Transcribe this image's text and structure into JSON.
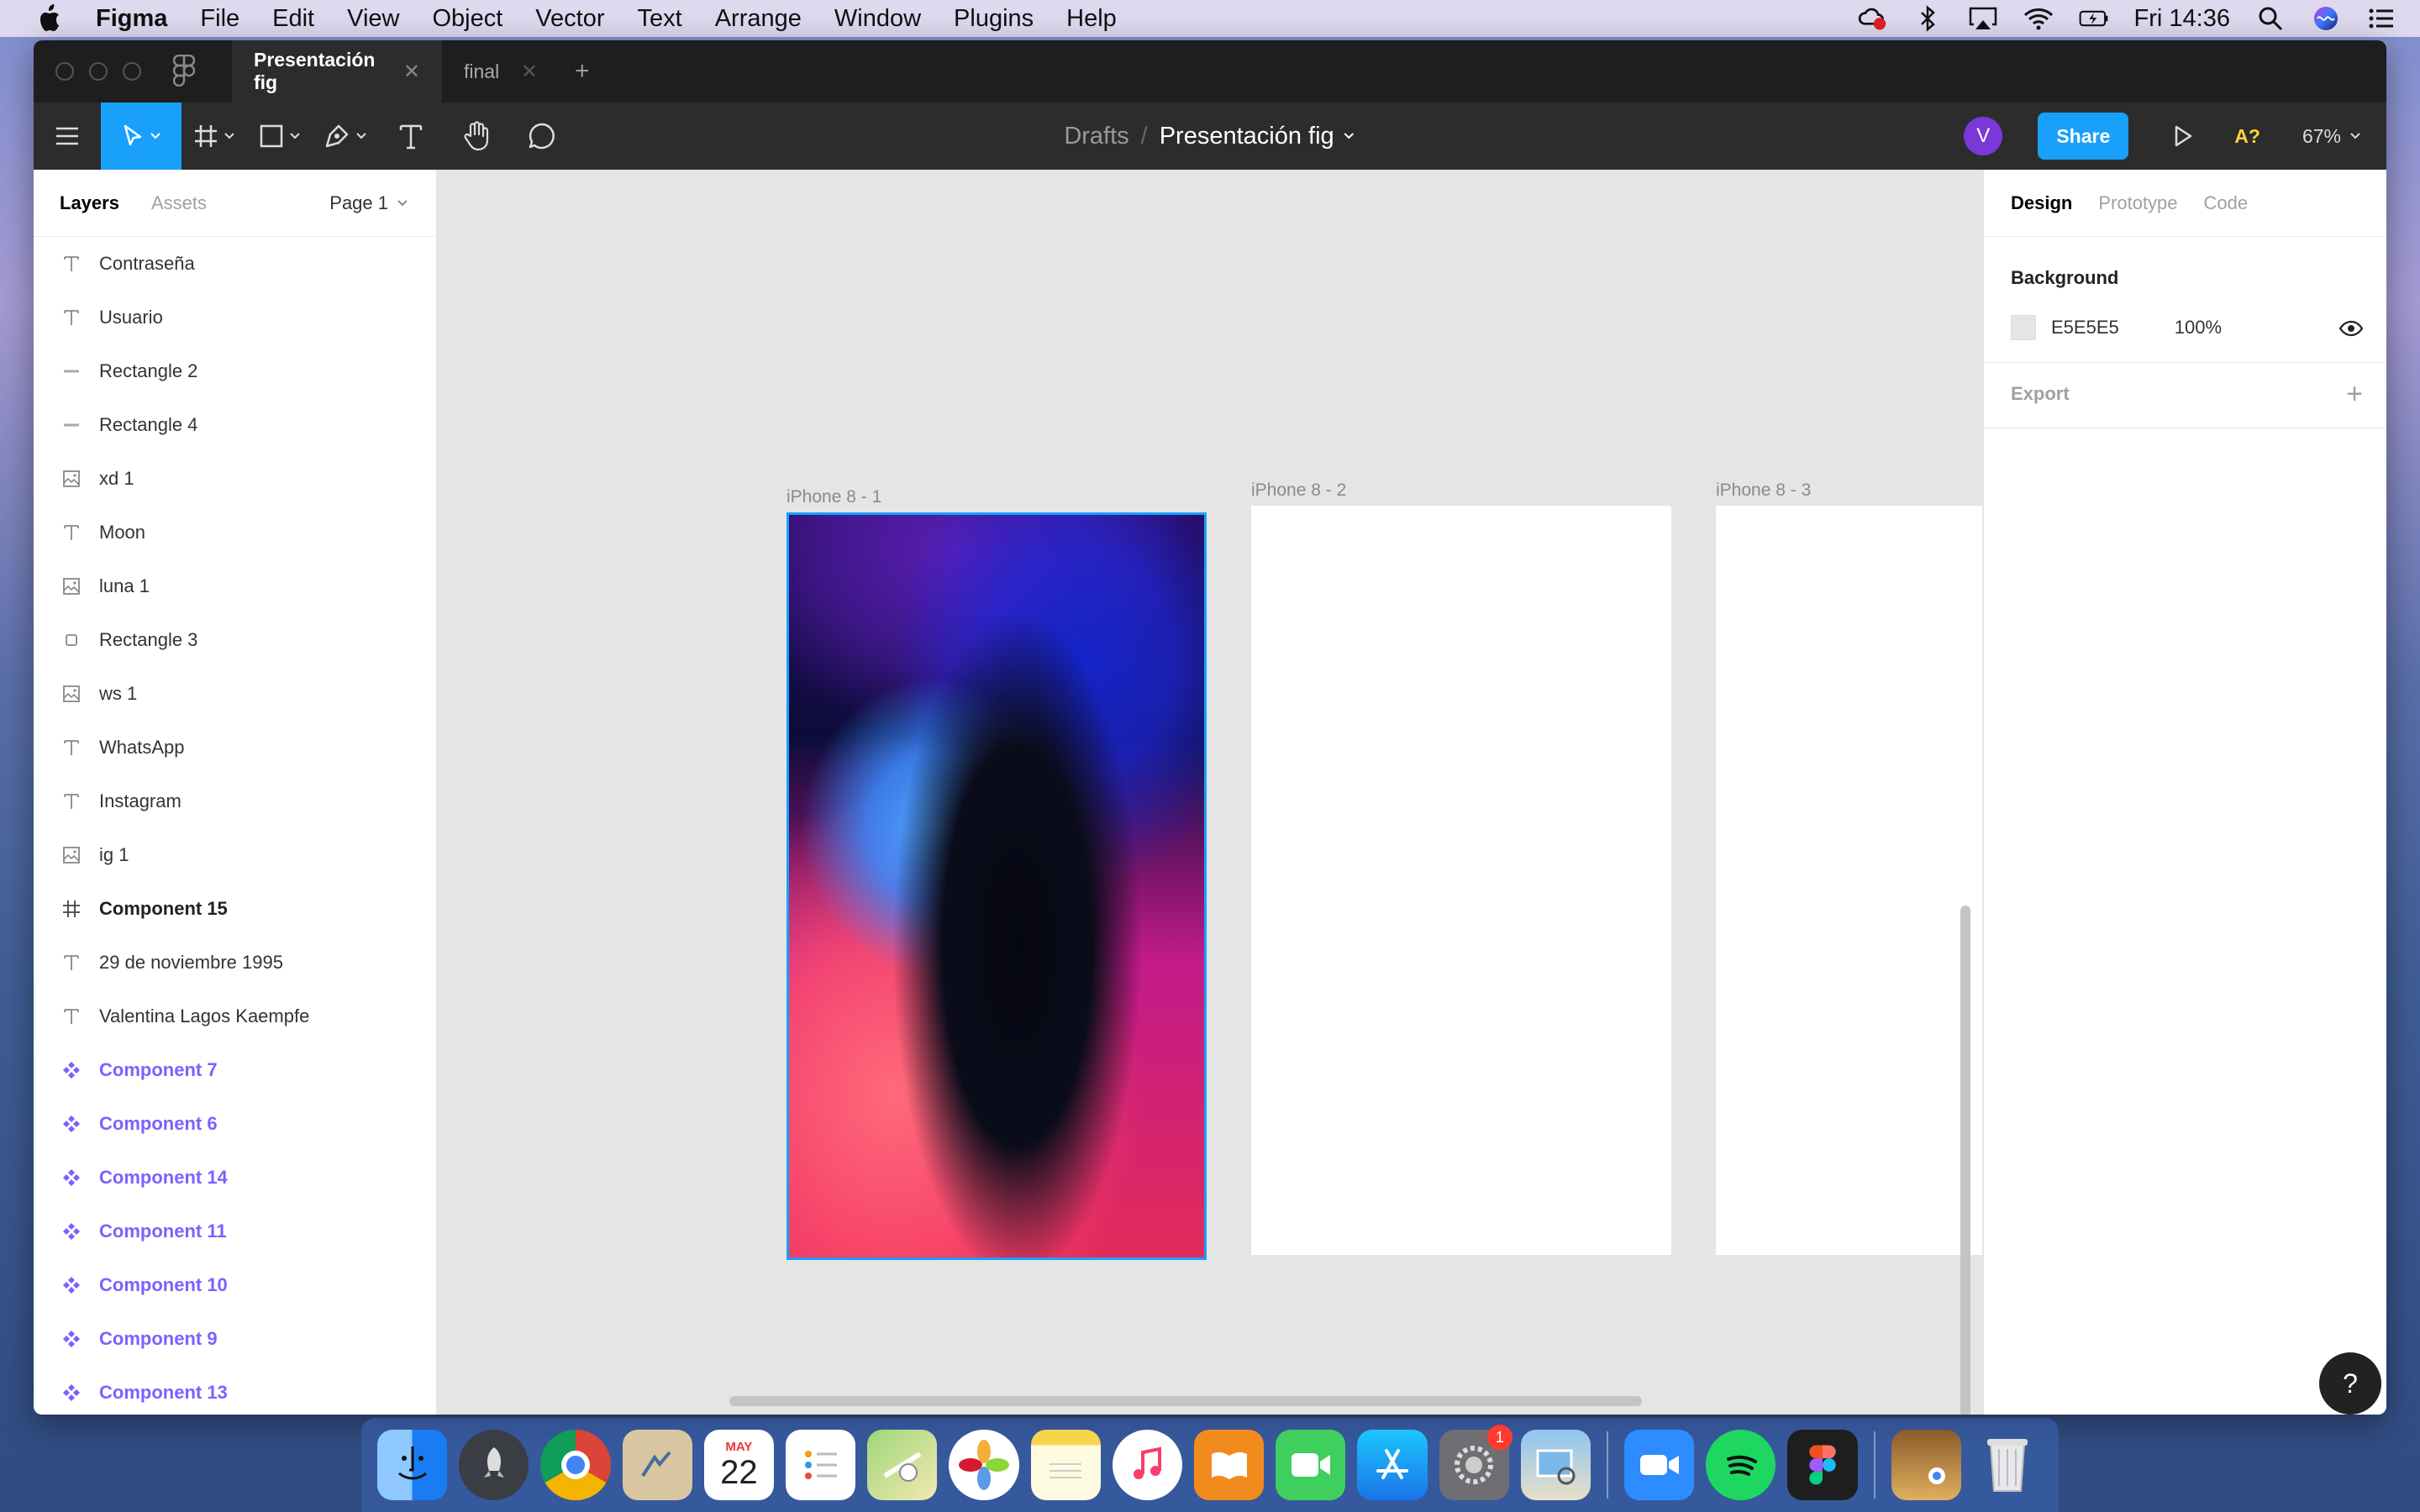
{
  "menubar": {
    "app_name": "Figma",
    "items": [
      "File",
      "Edit",
      "View",
      "Object",
      "Vector",
      "Text",
      "Arrange",
      "Window",
      "Plugins",
      "Help"
    ],
    "clock": "Fri 14:36"
  },
  "window": {
    "tabs": [
      {
        "label": "Presentación fig",
        "active": true
      },
      {
        "label": "final",
        "active": false
      }
    ],
    "breadcrumb": {
      "root": "Drafts",
      "separator": "/",
      "file": "Presentación fig"
    },
    "user_initial": "V",
    "share_label": "Share",
    "font_warning": "A?",
    "zoom": "67%"
  },
  "left_panel": {
    "tabs": [
      "Layers",
      "Assets"
    ],
    "page": "Page 1",
    "layers": [
      {
        "name": "Contraseña",
        "icon": "text-icon",
        "style": "normal"
      },
      {
        "name": "Usuario",
        "icon": "text-icon",
        "style": "normal"
      },
      {
        "name": "Rectangle 2",
        "icon": "line-icon",
        "style": "normal"
      },
      {
        "name": "Rectangle 4",
        "icon": "line-icon",
        "style": "normal"
      },
      {
        "name": "xd 1",
        "icon": "image-icon",
        "style": "normal"
      },
      {
        "name": "Moon",
        "icon": "text-icon",
        "style": "normal"
      },
      {
        "name": "luna 1",
        "icon": "image-icon",
        "style": "normal"
      },
      {
        "name": "Rectangle 3",
        "icon": "rectangle-icon",
        "style": "normal"
      },
      {
        "name": "ws 1",
        "icon": "image-icon",
        "style": "normal"
      },
      {
        "name": "WhatsApp",
        "icon": "text-icon",
        "style": "normal"
      },
      {
        "name": "Instagram",
        "icon": "text-icon",
        "style": "normal"
      },
      {
        "name": "ig 1",
        "icon": "image-icon",
        "style": "normal"
      },
      {
        "name": "Component 15",
        "icon": "frame-icon",
        "style": "bold"
      },
      {
        "name": "29 de noviembre 1995",
        "icon": "text-icon",
        "style": "normal"
      },
      {
        "name": "Valentina Lagos Kaempfe",
        "icon": "text-icon",
        "style": "normal"
      },
      {
        "name": "Component 7",
        "icon": "component-icon",
        "style": "component"
      },
      {
        "name": "Component 6",
        "icon": "component-icon",
        "style": "component"
      },
      {
        "name": "Component 14",
        "icon": "component-icon",
        "style": "component"
      },
      {
        "name": "Component 11",
        "icon": "component-icon",
        "style": "component"
      },
      {
        "name": "Component 10",
        "icon": "component-icon",
        "style": "component"
      },
      {
        "name": "Component 9",
        "icon": "component-icon",
        "style": "component"
      },
      {
        "name": "Component 13",
        "icon": "component-icon",
        "style": "component"
      }
    ]
  },
  "canvas": {
    "frames": [
      {
        "label": "iPhone 8 - 1",
        "selected": true
      },
      {
        "label": "iPhone 8 - 2",
        "selected": false
      },
      {
        "label": "iPhone 8 - 3",
        "selected": false
      }
    ]
  },
  "right_panel": {
    "tabs": [
      "Design",
      "Prototype",
      "Code"
    ],
    "background": {
      "title": "Background",
      "hex": "E5E5E5",
      "opacity": "100%"
    },
    "export": {
      "title": "Export"
    },
    "help": "?"
  },
  "dock": {
    "apps": [
      "finder-icon",
      "launchpad-icon",
      "chrome-icon",
      "mail-icon",
      "calendar-icon",
      "reminders-icon",
      "maps-icon",
      "photos-icon",
      "notes-icon",
      "music-icon",
      "books-icon",
      "facetime-icon",
      "app-store-icon",
      "system-preferences-icon",
      "preview-icon",
      "zoom-icon",
      "spotify-icon",
      "figma-icon",
      "downloads-icon",
      "trash-icon"
    ],
    "calendar_month": "MAY",
    "calendar_day": "22",
    "badge": "1"
  },
  "colors": {
    "figma_blue": "#18a0fb",
    "component_purple": "#7b61ff",
    "toolbar": "#2c2c2c",
    "canvas": "#e5e5e5"
  }
}
